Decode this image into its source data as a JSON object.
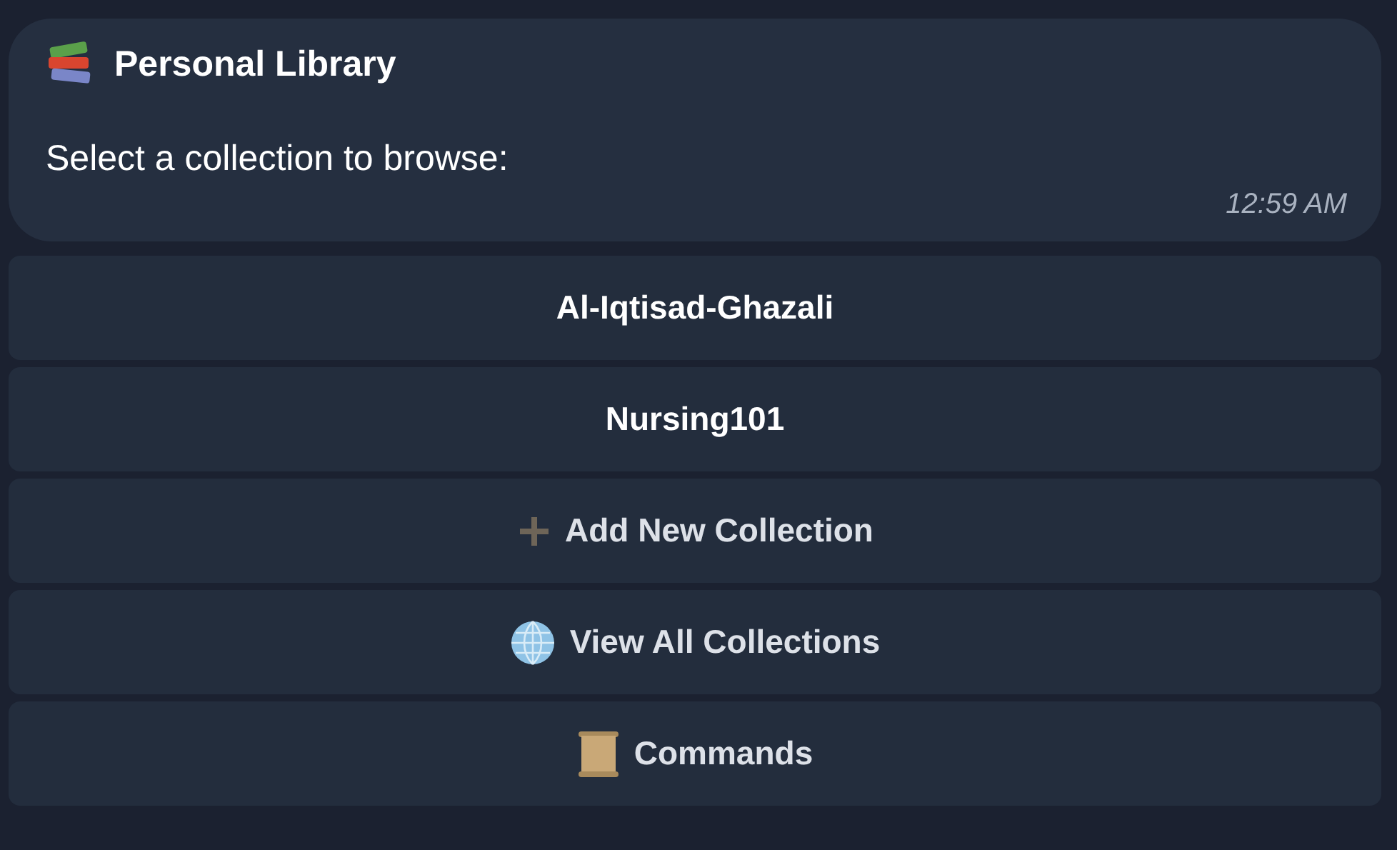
{
  "message": {
    "title": "Personal Library",
    "text": "Select a collection to browse:",
    "time": "12:59 AM"
  },
  "buttons": [
    {
      "label": "Al-Iqtisad-Ghazali",
      "kind": "plain"
    },
    {
      "label": "Nursing101",
      "kind": "plain"
    },
    {
      "label": "Add New Collection",
      "kind": "add"
    },
    {
      "label": "View All Collections",
      "kind": "globe"
    },
    {
      "label": "Commands",
      "kind": "scroll"
    }
  ]
}
